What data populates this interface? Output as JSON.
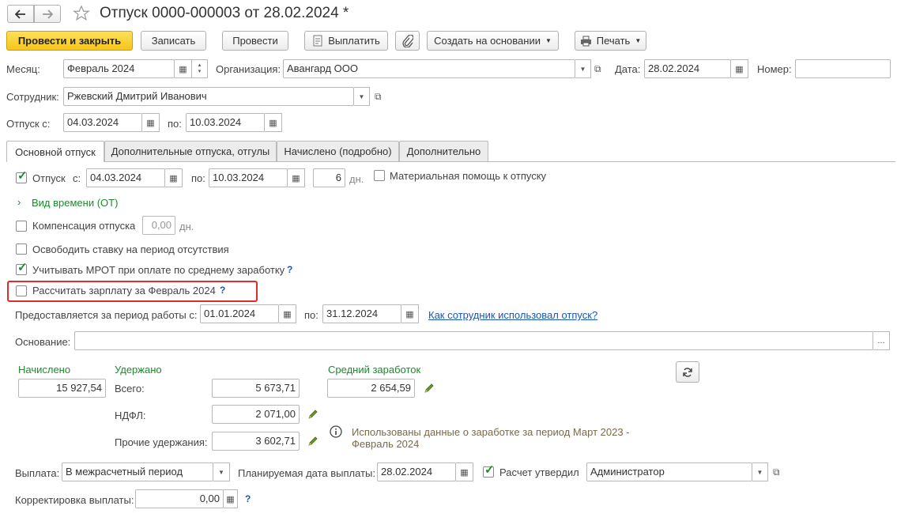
{
  "header": {
    "title": "Отпуск 0000-000003 от 28.02.2024 *"
  },
  "toolbar": {
    "post_close": "Провести и закрыть",
    "save": "Записать",
    "post": "Провести",
    "pay": "Выплатить",
    "create_based": "Создать на основании",
    "print": "Печать"
  },
  "form": {
    "month_label": "Месяц:",
    "month_value": "Февраль 2024",
    "org_label": "Организация:",
    "org_value": "Авангард ООО",
    "date_label": "Дата:",
    "date_value": "28.02.2024",
    "number_label": "Номер:",
    "number_value": "",
    "employee_label": "Сотрудник:",
    "employee_value": "Ржевский Дмитрий Иванович",
    "vac_from_label": "Отпуск с:",
    "vac_from_value": "04.03.2024",
    "vac_to_label": "по:",
    "vac_to_value": "10.03.2024"
  },
  "tabs": [
    {
      "label": "Основной отпуск"
    },
    {
      "label": "Дополнительные отпуска, отгулы"
    },
    {
      "label": "Начислено (подробно)"
    },
    {
      "label": "Дополнительно"
    }
  ],
  "main": {
    "vacation_label": "Отпуск",
    "from_label": "с:",
    "from_value": "04.03.2024",
    "to_label": "по:",
    "to_value": "10.03.2024",
    "days_value": "6",
    "days_unit": "дн.",
    "material_aid": "Материальная помощь к отпуску",
    "time_type": "Вид времени (ОТ)",
    "compensation": "Компенсация отпуска",
    "compensation_value": "0,00",
    "compensation_unit": "дн.",
    "free_rate": "Освободить ставку на период отсутствия",
    "mrot": "Учитывать МРОТ при оплате по среднему заработку",
    "calc_salary": "Рассчитать зарплату за Февраль 2024",
    "q": "?",
    "period_label": "Предоставляется за период работы с:",
    "period_from": "01.01.2024",
    "period_to_label": "по:",
    "period_to": "31.12.2024",
    "how_used_link": "Как сотрудник использовал отпуск?",
    "basis_label": "Основание:",
    "basis_value": "",
    "basis_btn": "..."
  },
  "totals": {
    "accrued_label": "Начислено",
    "accrued_value": "15 927,54",
    "withheld_label": "Удержано",
    "total_label": "Всего:",
    "total_value": "5 673,71",
    "ndfl_label": "НДФЛ:",
    "ndfl_value": "2 071,00",
    "other_label": "Прочие удержания:",
    "other_value": "3 602,71",
    "avg_label": "Средний заработок",
    "avg_value": "2 654,59",
    "info_text": "Использованы данные о заработке за период Март 2023 - Февраль 2024"
  },
  "payment": {
    "payout_label": "Выплата:",
    "payout_value": "В межрасчетный период",
    "planned_label": "Планируемая дата выплаты:",
    "planned_value": "28.02.2024",
    "approved_label": "Расчет утвердил",
    "approved_value": "Администратор",
    "correction_label": "Корректировка выплаты:",
    "correction_value": "0,00",
    "q": "?"
  },
  "colors": {
    "accent_yellow": "#f5c51a",
    "green": "#1c8a2e",
    "link": "#1a56b6",
    "highlight_red": "#d9302c"
  }
}
